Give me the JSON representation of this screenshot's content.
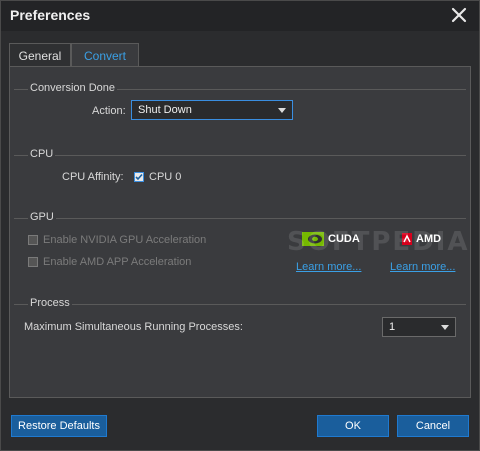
{
  "window": {
    "title": "Preferences"
  },
  "tabs": [
    {
      "label": "General"
    },
    {
      "label": "Convert"
    }
  ],
  "conversion_done": {
    "section_title": "Conversion Done",
    "action_label": "Action:",
    "action_value": "Shut Down"
  },
  "cpu": {
    "section_title": "CPU",
    "affinity_label": "CPU Affinity:",
    "cpu0_label": "CPU 0",
    "cpu0_checked": true
  },
  "gpu": {
    "section_title": "GPU",
    "nvidia_label": "Enable NVIDIA GPU Acceleration",
    "amd_label": "Enable AMD APP Acceleration",
    "cuda_text": "CUDA",
    "amd_text": "AMD",
    "learn_more_cuda": "Learn more...",
    "learn_more_amd": "Learn more...",
    "watermark": "SOFTPEDIA"
  },
  "process": {
    "section_title": "Process",
    "max_label": "Maximum Simultaneous Running Processes:",
    "max_value": "1"
  },
  "buttons": {
    "restore": "Restore Defaults",
    "ok": "OK",
    "cancel": "Cancel"
  },
  "colors": {
    "accent": "#3aa0e6",
    "button": "#1a5e9c",
    "nvidia_green": "#76b900",
    "amd_red": "#d6001c"
  }
}
